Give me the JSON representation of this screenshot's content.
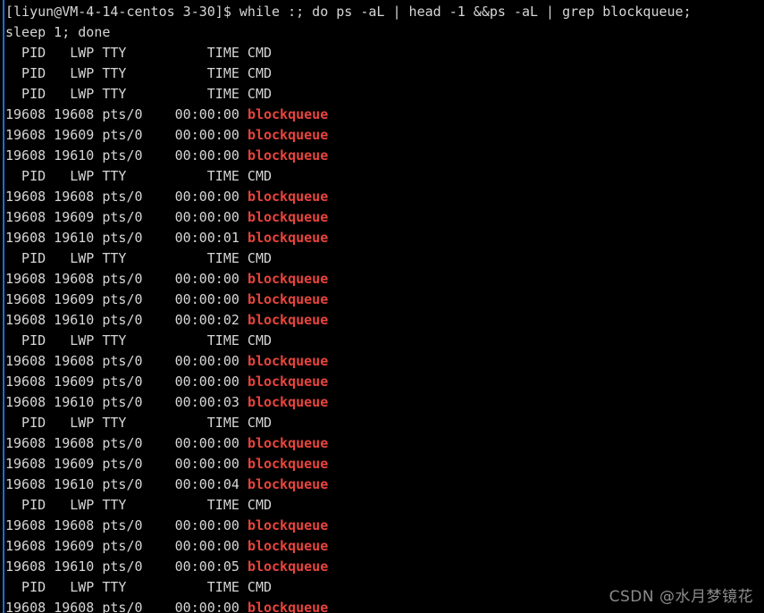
{
  "terminal": {
    "background_color": "#000000",
    "foreground_color": "#d6d6d6",
    "accent_color": "#1a6fd4",
    "highlight_color": "#e8443c",
    "prompt": "[liyun@VM-4-14-centos 3-30]$",
    "command": " while :; do ps -aL | head -1 &&ps -aL | grep blockqueue;",
    "command_wrap": "sleep 1; done",
    "header_row": "  PID   LWP TTY          TIME CMD",
    "process_name": "blockqueue",
    "lines": [
      {
        "kind": "command",
        "text": "[liyun@VM-4-14-centos 3-30]$ while :; do ps -aL | head -1 &&ps -aL | grep blockqueue;"
      },
      {
        "kind": "command",
        "text": "sleep 1; done"
      },
      {
        "kind": "header",
        "text": "  PID   LWP TTY          TIME CMD"
      },
      {
        "kind": "header",
        "text": "  PID   LWP TTY          TIME CMD"
      },
      {
        "kind": "header",
        "text": "  PID   LWP TTY          TIME CMD"
      },
      {
        "kind": "process",
        "prefix": "19608 19608 pts/0    00:00:00 ",
        "cmd": "blockqueue"
      },
      {
        "kind": "process",
        "prefix": "19608 19609 pts/0    00:00:00 ",
        "cmd": "blockqueue"
      },
      {
        "kind": "process",
        "prefix": "19608 19610 pts/0    00:00:00 ",
        "cmd": "blockqueue"
      },
      {
        "kind": "header",
        "text": "  PID   LWP TTY          TIME CMD"
      },
      {
        "kind": "process",
        "prefix": "19608 19608 pts/0    00:00:00 ",
        "cmd": "blockqueue"
      },
      {
        "kind": "process",
        "prefix": "19608 19609 pts/0    00:00:00 ",
        "cmd": "blockqueue"
      },
      {
        "kind": "process",
        "prefix": "19608 19610 pts/0    00:00:01 ",
        "cmd": "blockqueue"
      },
      {
        "kind": "header",
        "text": "  PID   LWP TTY          TIME CMD"
      },
      {
        "kind": "process",
        "prefix": "19608 19608 pts/0    00:00:00 ",
        "cmd": "blockqueue"
      },
      {
        "kind": "process",
        "prefix": "19608 19609 pts/0    00:00:00 ",
        "cmd": "blockqueue"
      },
      {
        "kind": "process",
        "prefix": "19608 19610 pts/0    00:00:02 ",
        "cmd": "blockqueue"
      },
      {
        "kind": "header",
        "text": "  PID   LWP TTY          TIME CMD"
      },
      {
        "kind": "process",
        "prefix": "19608 19608 pts/0    00:00:00 ",
        "cmd": "blockqueue"
      },
      {
        "kind": "process",
        "prefix": "19608 19609 pts/0    00:00:00 ",
        "cmd": "blockqueue"
      },
      {
        "kind": "process",
        "prefix": "19608 19610 pts/0    00:00:03 ",
        "cmd": "blockqueue"
      },
      {
        "kind": "header",
        "text": "  PID   LWP TTY          TIME CMD"
      },
      {
        "kind": "process",
        "prefix": "19608 19608 pts/0    00:00:00 ",
        "cmd": "blockqueue"
      },
      {
        "kind": "process",
        "prefix": "19608 19609 pts/0    00:00:00 ",
        "cmd": "blockqueue"
      },
      {
        "kind": "process",
        "prefix": "19608 19610 pts/0    00:00:04 ",
        "cmd": "blockqueue"
      },
      {
        "kind": "header",
        "text": "  PID   LWP TTY          TIME CMD"
      },
      {
        "kind": "process",
        "prefix": "19608 19608 pts/0    00:00:00 ",
        "cmd": "blockqueue"
      },
      {
        "kind": "process",
        "prefix": "19608 19609 pts/0    00:00:00 ",
        "cmd": "blockqueue"
      },
      {
        "kind": "process",
        "prefix": "19608 19610 pts/0    00:00:05 ",
        "cmd": "blockqueue"
      },
      {
        "kind": "header",
        "text": "  PID   LWP TTY          TIME CMD"
      },
      {
        "kind": "process",
        "prefix": "19608 19608 pts/0    00:00:00 ",
        "cmd": "blockqueue"
      }
    ]
  },
  "watermark": {
    "text": "CSDN @水月梦镜花"
  }
}
